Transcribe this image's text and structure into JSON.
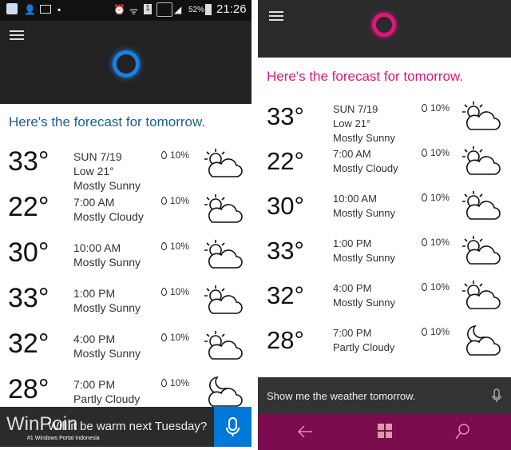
{
  "left": {
    "status_bar": {
      "battery": "52%",
      "time": "21:26",
      "icons": [
        "cortana-icon",
        "contact-icon",
        "image-icon",
        "bbm-icon",
        "alarm-icon",
        "wifi-icon",
        "sim-icon",
        "signal-icon",
        "signal-icon",
        "battery-icon"
      ]
    },
    "title": "Here's the forecast for tomorrow.",
    "rows": [
      {
        "temp": "33°",
        "line1": "SUN 7/19",
        "line2": "Low 21°",
        "line3": "Mostly Sunny",
        "rain": "10%",
        "icon": "sun-cloud-icon"
      },
      {
        "temp": "22°",
        "line1": "7:00 AM",
        "line2": "Mostly Cloudy",
        "rain": "10%",
        "icon": "sun-cloud-icon"
      },
      {
        "temp": "30°",
        "line1": "10:00 AM",
        "line2": "Mostly Sunny",
        "rain": "10%",
        "icon": "sun-cloud-icon"
      },
      {
        "temp": "33°",
        "line1": "1:00 PM",
        "line2": "Mostly Sunny",
        "rain": "10%",
        "icon": "sun-cloud-icon"
      },
      {
        "temp": "32°",
        "line1": "4:00 PM",
        "line2": "Mostly Sunny",
        "rain": "10%",
        "icon": "sun-cloud-icon"
      },
      {
        "temp": "28°",
        "line1": "7:00 PM",
        "line2": "Partly Cloudy",
        "rain": "10%",
        "icon": "moon-cloud-icon"
      }
    ],
    "query": "Will it be warm next Tuesday?",
    "accent": "#0078d7",
    "title_color": "#1d5f8f"
  },
  "right": {
    "title": "Here's the forecast for tomorrow.",
    "rows": [
      {
        "temp": "33°",
        "line1": "SUN 7/19",
        "line2": "Low 21°",
        "line3": "Mostly Sunny",
        "rain": "10%",
        "icon": "sun-cloud-icon"
      },
      {
        "temp": "22°",
        "line1": "7:00 AM",
        "line2": "Mostly Cloudy",
        "rain": "10%",
        "icon": "sun-cloud-icon"
      },
      {
        "temp": "30°",
        "line1": "10:00 AM",
        "line2": "Mostly Sunny",
        "rain": "10%",
        "icon": "sun-cloud-icon"
      },
      {
        "temp": "33°",
        "line1": "1:00 PM",
        "line2": "Mostly Sunny",
        "rain": "10%",
        "icon": "sun-cloud-icon"
      },
      {
        "temp": "32°",
        "line1": "4:00 PM",
        "line2": "Mostly Sunny",
        "rain": "10%",
        "icon": "sun-cloud-icon"
      },
      {
        "temp": "28°",
        "line1": "7:00 PM",
        "line2": "Partly Cloudy",
        "rain": "10%",
        "icon": "moon-cloud-icon"
      }
    ],
    "query": "Show me the weather tomorrow.",
    "accent": "#e3157a",
    "nav_color": "#7a0b4c"
  },
  "watermark": {
    "brand": "WinPoin",
    "tagline": "#1 Windows Portal Indonesia"
  }
}
